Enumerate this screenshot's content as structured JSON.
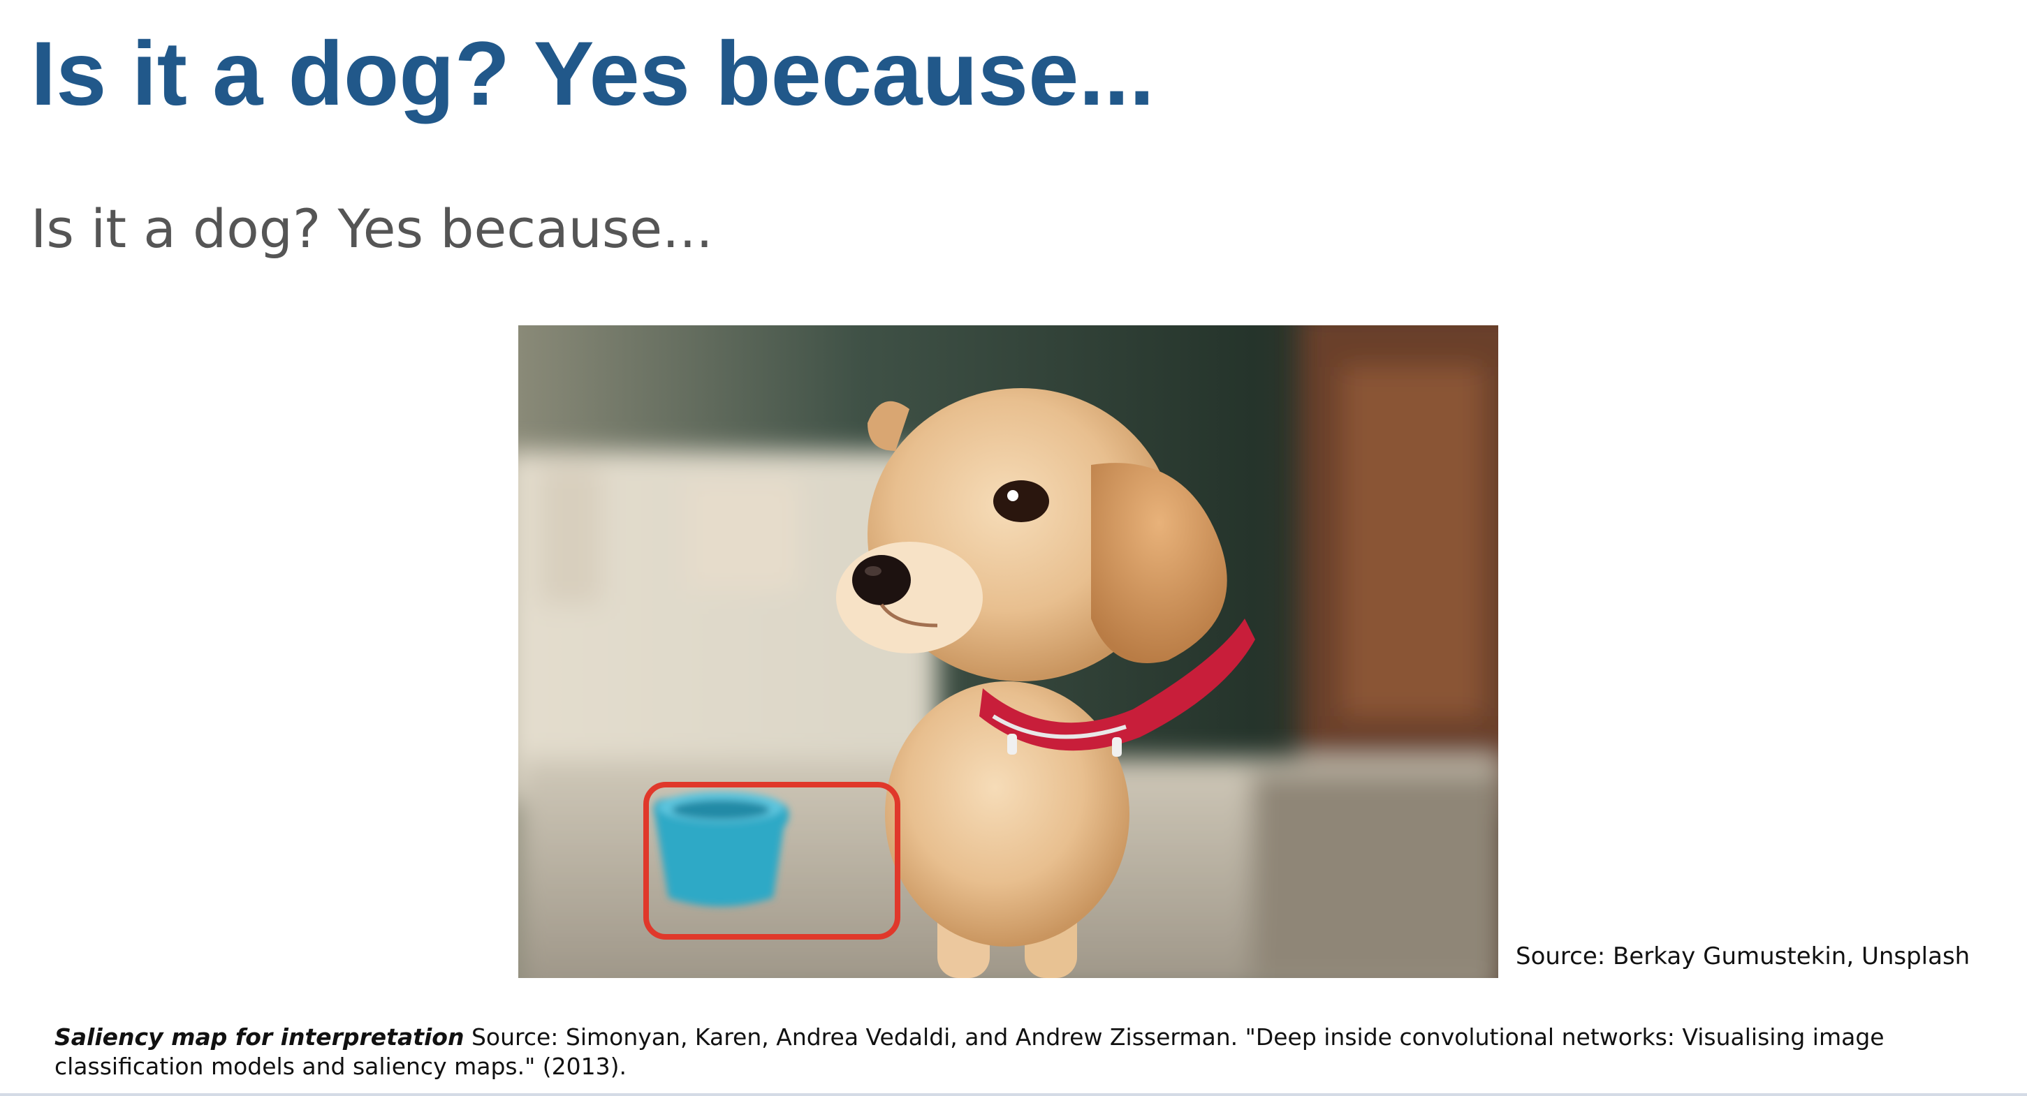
{
  "slide": {
    "title": "Is it a dog? Yes because...",
    "subtitle": "Is it a dog? Yes because...",
    "photo_credit": "Source: Berkay Gumustekin, Unsplash",
    "footer": {
      "emphasis": "Saliency map for interpretation",
      "source": " Source: Simonyan, Karen, Andrea Vedaldi, and Andrew Zisserman. \"Deep inside convolutional networks: Visualising image classification models and saliency maps.\" (2013)."
    }
  },
  "colors": {
    "title": "#21588a",
    "subtitle": "#555555",
    "highlight_box": "#e0382b",
    "bowl": "#2fa9c6"
  },
  "icons": {
    "photo": "puppy-photo",
    "highlight": "highlight-box"
  }
}
